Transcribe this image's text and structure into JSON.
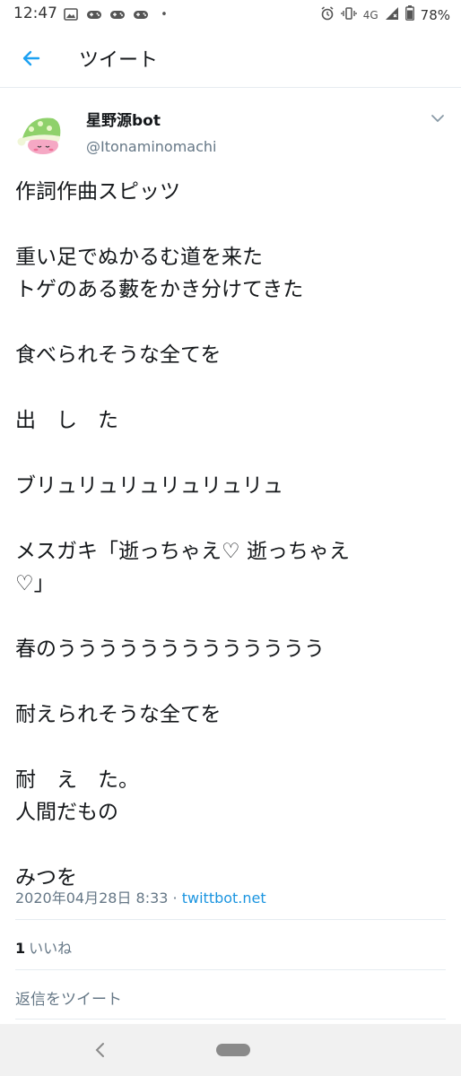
{
  "status_bar": {
    "time": "12:47",
    "network": "4G",
    "battery": "78%",
    "dot": "•"
  },
  "header": {
    "back_icon": "arrow-left-icon",
    "title": "ツイート"
  },
  "tweet": {
    "user": {
      "name": "星野源bot",
      "handle": "@Itonaminomachi"
    },
    "body": {
      "l1": "作詞作曲スピッツ",
      "l2": "重い足でぬかるむ道を来た",
      "l3": "トゲのある藪をかき分けてきた",
      "l4": "食べられそうな全てを",
      "l5": "出　し　た",
      "l6": "ブリュリュリュリュリュリュ",
      "l7": "メスガキ「逝っちゃえ♡ 逝っちゃえ",
      "l8": "♡」",
      "l9": "春のううううううううううううう",
      "l10": "耐えられそうな全てを",
      "l11": "耐　え　た。",
      "l12": "人間だもの",
      "l13": "みつを"
    },
    "meta": {
      "datetime": "2020年04月28日 8:33",
      "separator": " · ",
      "source": "twittbot.net"
    },
    "likes": {
      "count": "1",
      "label": "いいね"
    },
    "reply_placeholder": "返信をツイート"
  },
  "colors": {
    "accent": "#1da1f2",
    "text": "#14171a",
    "secondary": "#657786",
    "divider": "#e6ecf0"
  }
}
